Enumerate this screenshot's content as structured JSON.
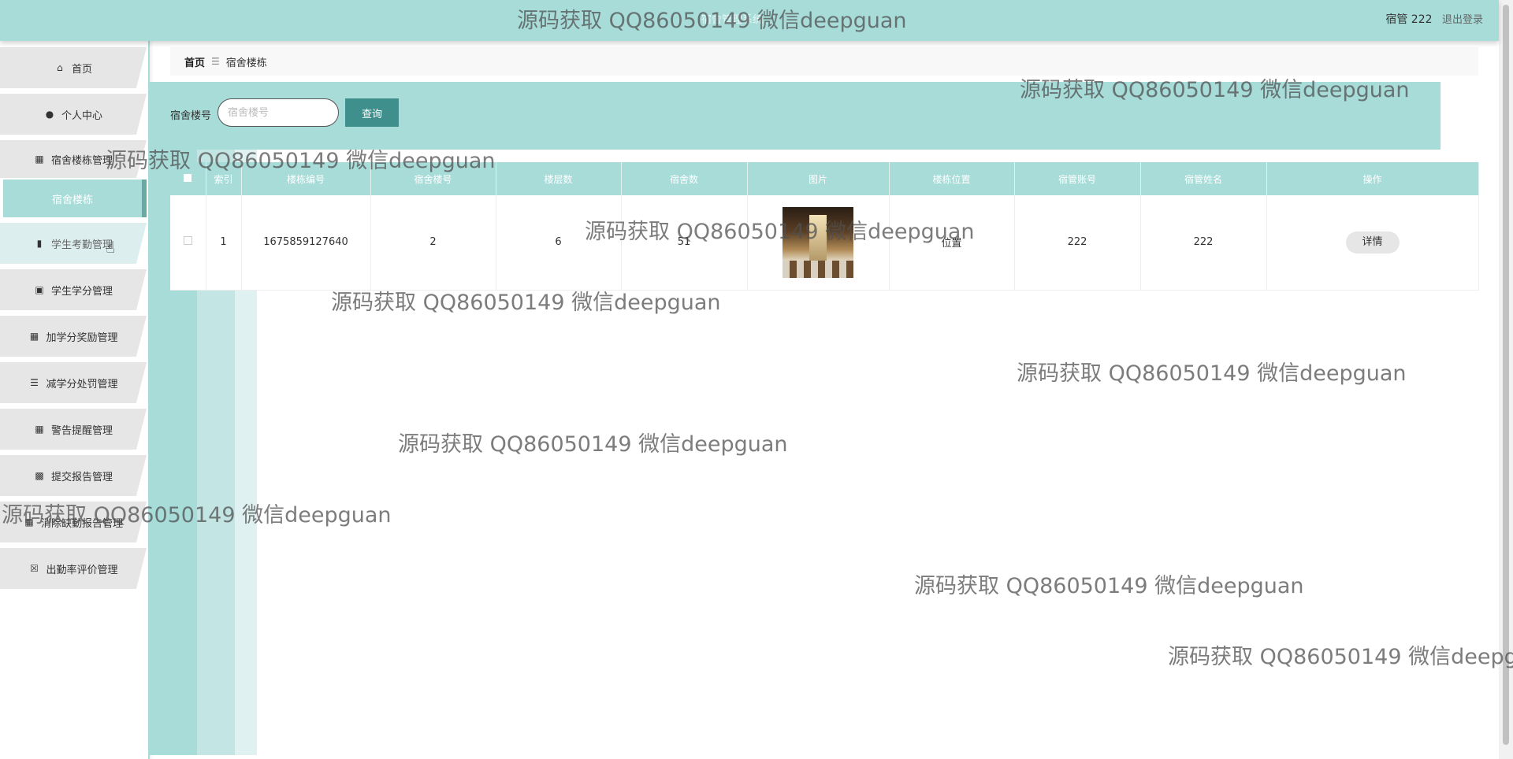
{
  "header": {
    "system_title": "宿舍管理系统",
    "user_label": "宿管 222",
    "logout_label": "退出登录"
  },
  "sidebar": {
    "items": [
      {
        "label": "首页",
        "icon": "home-icon"
      },
      {
        "label": "个人中心",
        "icon": "user-icon"
      },
      {
        "label": "宿舍楼栋管理",
        "icon": "grid-icon"
      },
      {
        "label": "学生考勤管理",
        "icon": "clipboard-icon"
      },
      {
        "label": "学生学分管理",
        "icon": "ticket-icon"
      },
      {
        "label": "加学分奖励管理",
        "icon": "grid-icon"
      },
      {
        "label": "减学分处罚管理",
        "icon": "list-icon"
      },
      {
        "label": "警告提醒管理",
        "icon": "grid-icon"
      },
      {
        "label": "提交报告管理",
        "icon": "briefcase-icon"
      },
      {
        "label": "消除缺勤报告管理",
        "icon": "grid-icon"
      },
      {
        "label": "出勤率评价管理",
        "icon": "clipboard-x-icon"
      }
    ],
    "active_submenu": "宿舍楼栋"
  },
  "breadcrumb": {
    "home": "首页",
    "separator": "☰",
    "current": "宿舍楼栋"
  },
  "search": {
    "label": "宿舍楼号",
    "placeholder": "宿舍楼号",
    "value": "",
    "button_label": "查询"
  },
  "table": {
    "columns": [
      "索引",
      "楼栋编号",
      "宿舍楼号",
      "楼层数",
      "宿舍数",
      "图片",
      "楼栋位置",
      "宿管账号",
      "宿管姓名",
      "操作"
    ],
    "rows": [
      {
        "index": "1",
        "building_no": "1675859127640",
        "dorm_building": "2",
        "floors": "6",
        "rooms": "51",
        "image": "dorm-photo",
        "location": "位置",
        "manager_account": "222",
        "manager_name": "222",
        "action_label": "详情"
      }
    ]
  },
  "watermarks": {
    "text": "源码获取 QQ86050149 微信deepguan"
  }
}
